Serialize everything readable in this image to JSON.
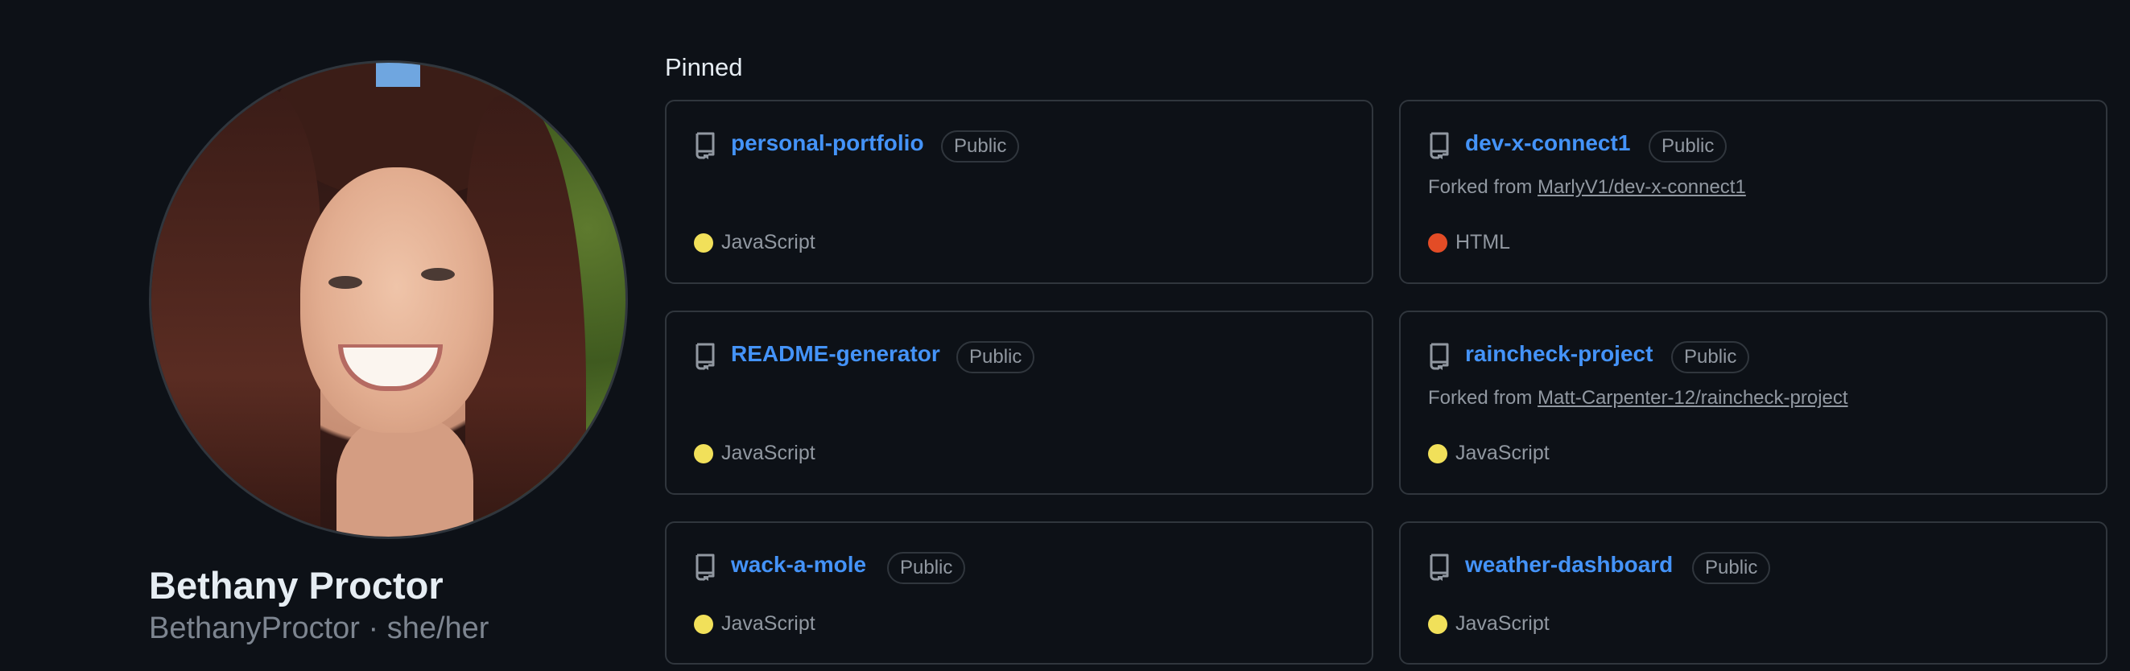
{
  "profile": {
    "name": "Bethany Proctor",
    "handle": "BethanyProctor · she/her"
  },
  "pinned": {
    "title": "Pinned",
    "repos": [
      {
        "name": "personal-portfolio",
        "visibility": "Public",
        "forked_prefix": "",
        "forked_from": "",
        "language": "JavaScript",
        "language_color": "#f1e05a"
      },
      {
        "name": "dev-x-connect1",
        "visibility": "Public",
        "forked_prefix": "Forked from",
        "forked_from": "MarlyV1/dev-x-connect1",
        "language": "HTML",
        "language_color": "#e34c26"
      },
      {
        "name": "README-generator",
        "visibility": "Public",
        "forked_prefix": "",
        "forked_from": "",
        "language": "JavaScript",
        "language_color": "#f1e05a"
      },
      {
        "name": "raincheck-project",
        "visibility": "Public",
        "forked_prefix": "Forked from",
        "forked_from": "Matt-Carpenter-12/raincheck-project",
        "language": "JavaScript",
        "language_color": "#f1e05a"
      },
      {
        "name": "wack-a-mole",
        "visibility": "Public",
        "forked_prefix": "",
        "forked_from": "",
        "language": "JavaScript",
        "language_color": "#f1e05a"
      },
      {
        "name": "weather-dashboard",
        "visibility": "Public",
        "forked_prefix": "",
        "forked_from": "",
        "language": "JavaScript",
        "language_color": "#f1e05a"
      }
    ]
  },
  "icons": {
    "repo": "repo-icon",
    "language": "language-color-dot"
  }
}
